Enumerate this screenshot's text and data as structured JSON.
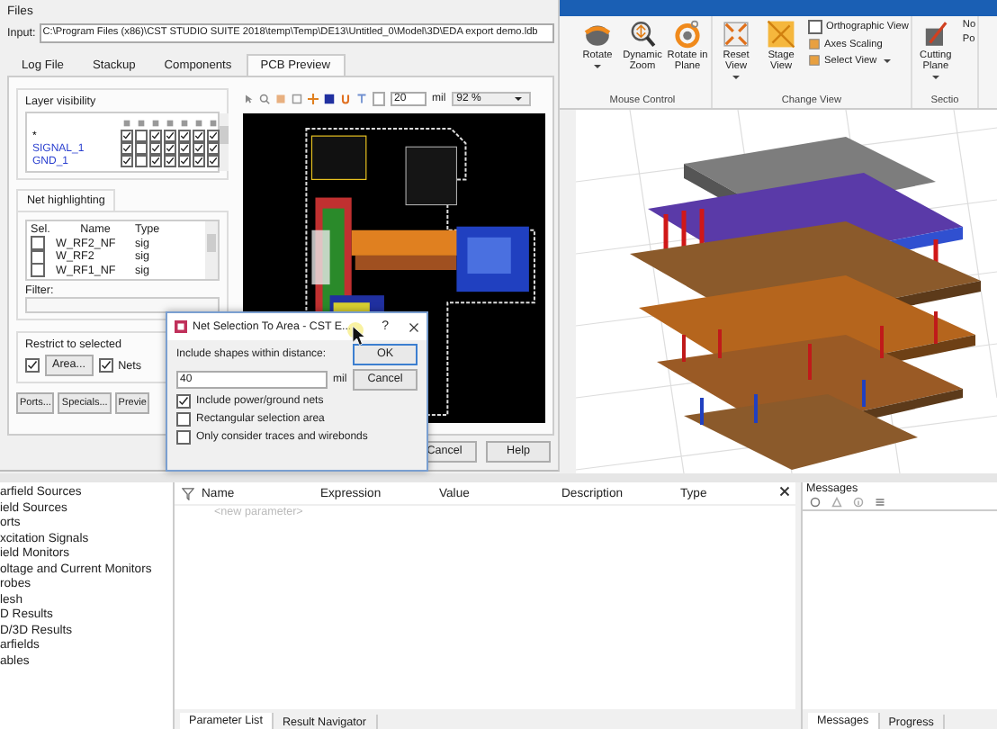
{
  "ribbon": {
    "groups": [
      {
        "label": "Mouse Control",
        "buttons": [
          {
            "label": "Rotate",
            "dropdown": true
          },
          {
            "label": "Dynamic Zoom",
            "dropdown": false
          },
          {
            "label": "Rotate in Plane",
            "dropdown": false
          }
        ]
      },
      {
        "label": "Change View",
        "buttons": [
          {
            "label": "Reset View",
            "dropdown": true
          },
          {
            "label": "Stage View",
            "dropdown": false
          }
        ],
        "small": [
          {
            "kind": "checkbox",
            "label": "Orthographic View",
            "checked": false
          },
          {
            "kind": "button",
            "label": "Axes Scaling",
            "dropdown": false
          },
          {
            "kind": "button",
            "label": "Select View",
            "dropdown": true
          }
        ]
      },
      {
        "label": "Sectio",
        "buttons": [
          {
            "label": "Cutting Plane",
            "dropdown": true
          }
        ],
        "small": [
          {
            "kind": "text",
            "label": "No"
          },
          {
            "kind": "text",
            "label": "Po"
          }
        ]
      }
    ]
  },
  "navigation_tree": {
    "items": [
      {
        "label": "arfield Sources"
      },
      {
        "label": "ield Sources"
      },
      {
        "label": "orts"
      },
      {
        "label": "xcitation Signals"
      },
      {
        "label": "ield Monitors"
      },
      {
        "label": "oltage and Current Monitors"
      },
      {
        "label": "robes"
      },
      {
        "label": "lesh"
      },
      {
        "label": "D Results"
      },
      {
        "label": "D/3D Results"
      },
      {
        "label": "arfields"
      },
      {
        "label": "ables"
      }
    ]
  },
  "parameter_list": {
    "columns": [
      "Name",
      "Expression",
      "Value",
      "Description",
      "Type"
    ],
    "new_row": "<new parameter>",
    "tabs": [
      {
        "label": "Parameter List",
        "selected": true
      },
      {
        "label": "Result Navigator",
        "selected": false
      }
    ]
  },
  "messages": {
    "title": "Messages",
    "tabs": [
      {
        "label": "Messages",
        "selected": true
      },
      {
        "label": "Progress",
        "selected": false
      }
    ]
  },
  "export_dialog": {
    "files_title": "Files",
    "input_label": "Input:",
    "input_value": "C:\\Program Files (x86)\\CST STUDIO SUITE 2018\\temp\\Temp\\DE13\\Untitled_0\\Model\\3D\\EDA export demo.ldb",
    "tabs": [
      {
        "label": "Log File",
        "selected": false
      },
      {
        "label": "Stackup",
        "selected": false
      },
      {
        "label": "Components",
        "selected": false
      },
      {
        "label": "PCB Preview",
        "selected": true
      }
    ],
    "layer_visibility": {
      "title": "Layer visibility",
      "rows": [
        {
          "name": "*",
          "kind": "all",
          "checks": [
            true,
            false,
            true,
            true,
            true,
            true,
            true
          ]
        },
        {
          "name": "SIGNAL_1",
          "kind": "layer",
          "checks": [
            true,
            false,
            true,
            true,
            true,
            true,
            true
          ]
        },
        {
          "name": "GND_1",
          "kind": "layer",
          "checks": [
            true,
            false,
            true,
            true,
            true,
            true,
            true
          ]
        }
      ]
    },
    "net_highlighting": {
      "tab": "Net highlighting",
      "columns": [
        "Sel.",
        "Name",
        "Type"
      ],
      "rows": [
        {
          "name": "W_RF2_NF",
          "type": "sig",
          "checked": false
        },
        {
          "name": "W_RF2",
          "type": "sig",
          "checked": false
        },
        {
          "name": "W_RF1_NF",
          "type": "sig",
          "checked": false
        }
      ],
      "filter_label": "Filter:"
    },
    "restrict": {
      "title": "Restrict to selected",
      "items": [
        {
          "kind": "button",
          "label": "Area...",
          "checked": true
        },
        {
          "kind": "label",
          "label": "Nets",
          "checked": true
        }
      ]
    },
    "buttons": [
      "Ports...",
      "Specials...",
      "Previe"
    ],
    "preview_toolbar": {
      "grid": "20",
      "unit": "mil",
      "zoom": "92 %"
    },
    "footer_buttons": [
      "Cancel",
      "Help"
    ]
  },
  "net_dialog": {
    "title": "Net Selection To Area - CST E...",
    "help_mark": "?",
    "distance_label": "Include shapes within distance:",
    "distance_value": "40",
    "unit": "mil",
    "buttons": [
      "OK",
      "Cancel"
    ],
    "options": [
      {
        "label": "Include power/ground nets",
        "checked": true
      },
      {
        "label": "Rectangular selection area",
        "checked": false
      },
      {
        "label": "Only consider traces and wirebonds",
        "checked": false
      }
    ]
  }
}
